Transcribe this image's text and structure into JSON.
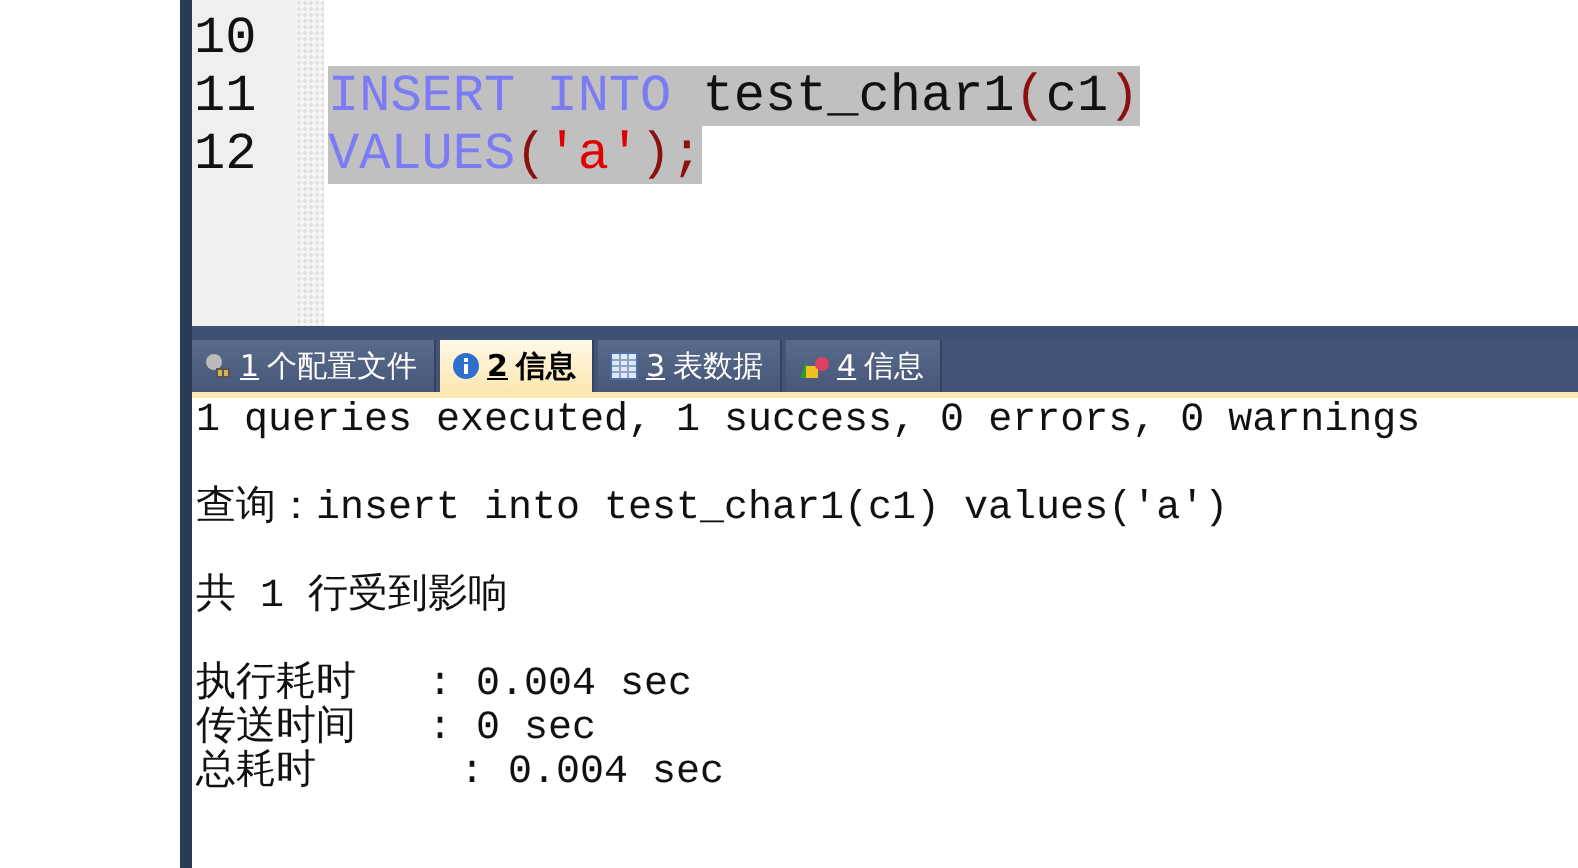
{
  "editor": {
    "lines": [
      {
        "number": "10"
      },
      {
        "number": "11",
        "selected": true,
        "tokens": [
          {
            "kind": "keyword",
            "text": "INSERT INTO"
          },
          {
            "kind": "plain",
            "text": " test_char1"
          },
          {
            "kind": "paren",
            "text": "("
          },
          {
            "kind": "plain",
            "text": "c1"
          },
          {
            "kind": "paren",
            "text": ")"
          }
        ]
      },
      {
        "number": "12",
        "selected": true,
        "tokens": [
          {
            "kind": "keyword",
            "text": "VALUES"
          },
          {
            "kind": "paren",
            "text": "("
          },
          {
            "kind": "string",
            "text": "'a'"
          },
          {
            "kind": "paren",
            "text": ")"
          },
          {
            "kind": "paren",
            "text": ";"
          }
        ]
      }
    ]
  },
  "result_tabs": [
    {
      "key": "1",
      "label": "个配置文件",
      "selected": false
    },
    {
      "key": "2",
      "label": "信息",
      "selected": true
    },
    {
      "key": "3",
      "label": "表数据",
      "selected": false
    },
    {
      "key": "4",
      "label": "信息",
      "selected": false
    }
  ],
  "output": {
    "groups": [
      [
        "1 queries executed, 1 success, 0 errors, 0 warnings"
      ],
      [
        "查询：insert into test_char1(c1) values('a')"
      ],
      [
        "共 1 行受到影响"
      ],
      [
        "执行耗时   : 0.004 sec",
        "传送时间   : 0 sec",
        "总耗时      : 0.004 sec"
      ]
    ]
  }
}
